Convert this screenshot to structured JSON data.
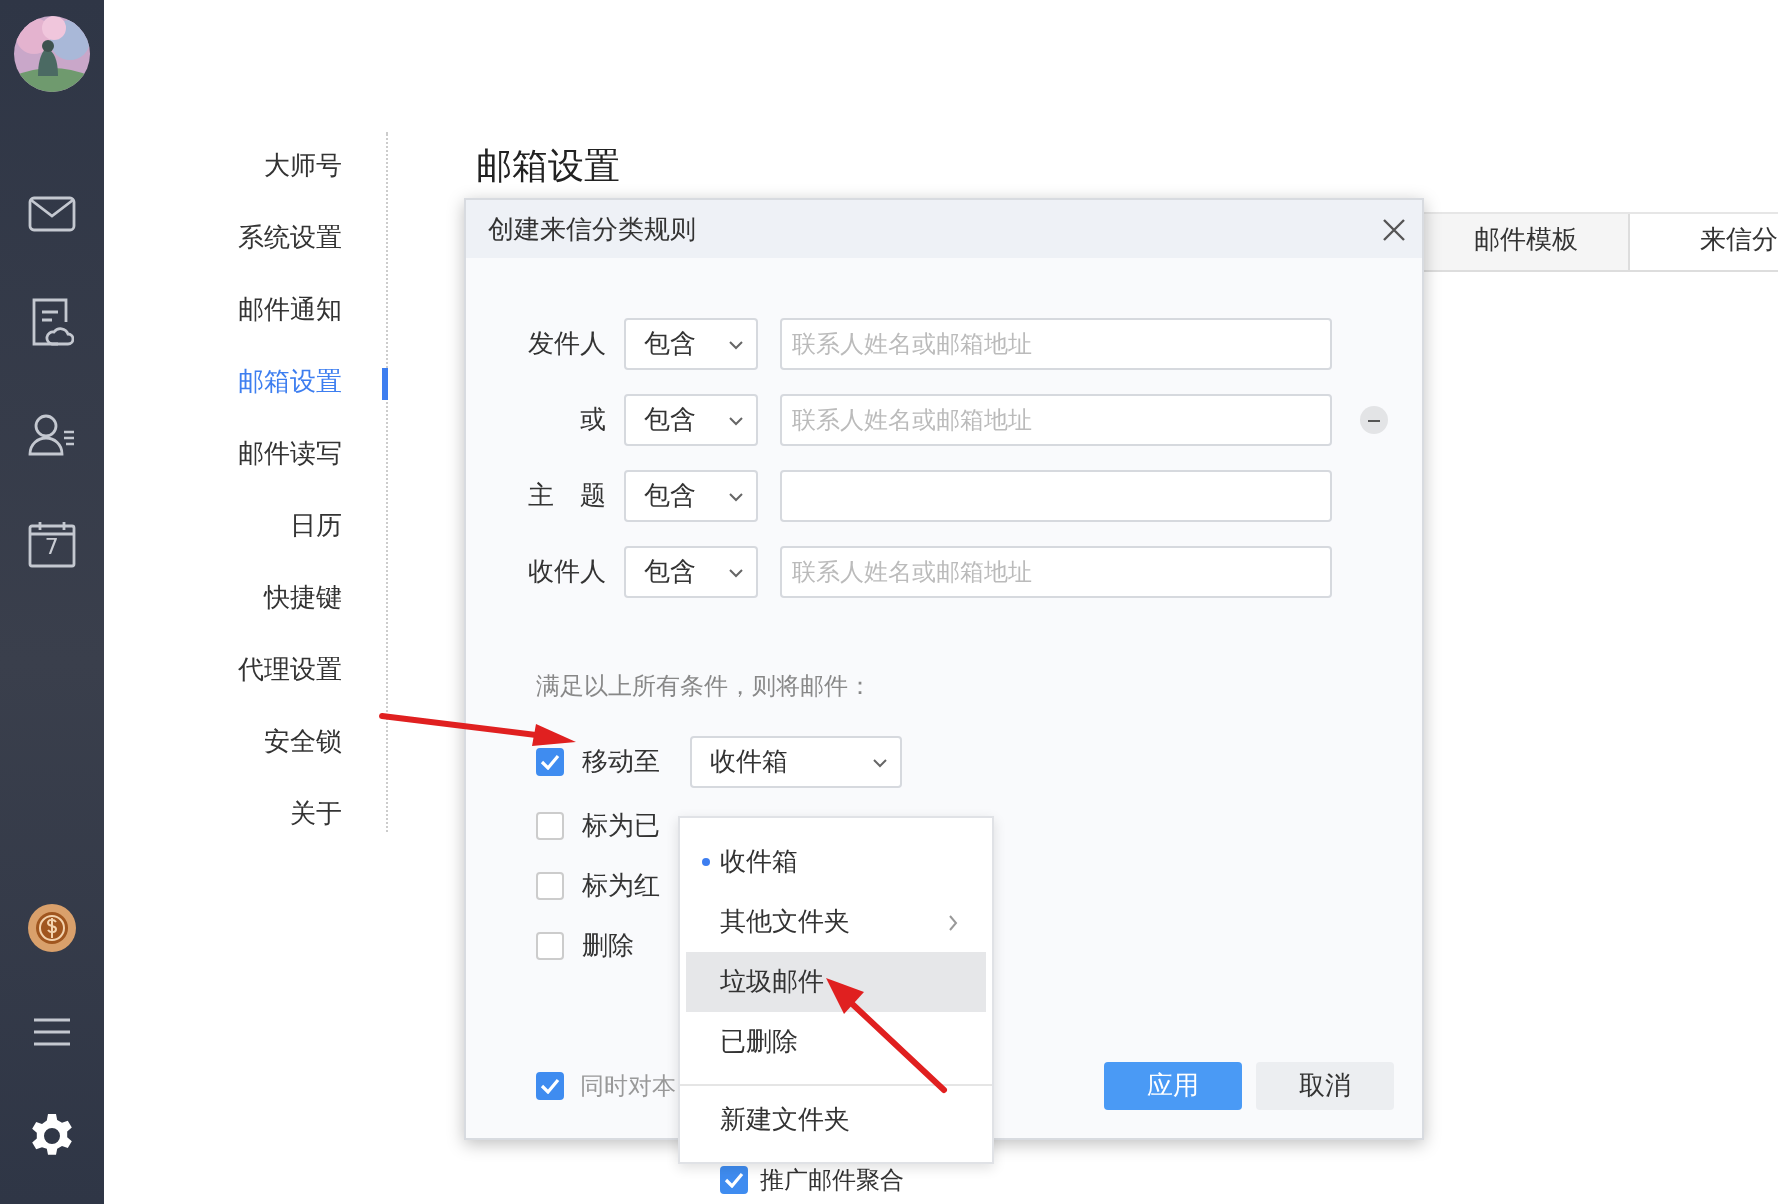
{
  "sidebar": {
    "calendar_day": "7"
  },
  "settings_nav": [
    {
      "label": "大师号",
      "selected": false
    },
    {
      "label": "系统设置",
      "selected": false
    },
    {
      "label": "邮件通知",
      "selected": false
    },
    {
      "label": "邮箱设置",
      "selected": true
    },
    {
      "label": "邮件读写",
      "selected": false
    },
    {
      "label": "日历",
      "selected": false
    },
    {
      "label": "快捷键",
      "selected": false
    },
    {
      "label": "代理设置",
      "selected": false
    },
    {
      "label": "安全锁",
      "selected": false
    },
    {
      "label": "关于",
      "selected": false
    }
  ],
  "page_title": "邮箱设置",
  "tabs": [
    {
      "label": "邮件模板",
      "selected": false
    },
    {
      "label": "来信分",
      "selected": true
    }
  ],
  "background_option": {
    "label": "推广邮件聚合",
    "checked": true
  },
  "dialog": {
    "title": "创建来信分类规则",
    "conditions": [
      {
        "label": "发件人",
        "operator": "包含",
        "placeholder": "联系人姓名或邮箱地址",
        "removable": false
      },
      {
        "label": "或",
        "operator": "包含",
        "placeholder": "联系人姓名或邮箱地址",
        "removable": true
      },
      {
        "label": "主　题",
        "operator": "包含",
        "removable": false
      },
      {
        "label": "收件人",
        "operator": "包含",
        "placeholder": "联系人姓名或邮箱地址",
        "removable": false
      }
    ],
    "action_prompt": "满足以上所有条件，则将邮件：",
    "actions": [
      {
        "kind": "select",
        "label": "移动至",
        "checked": true,
        "value": "收件箱"
      },
      {
        "kind": "plain",
        "label": "标为已",
        "checked": false
      },
      {
        "kind": "plain",
        "label": "标为红",
        "checked": false
      },
      {
        "kind": "plain",
        "label": "删除",
        "checked": false
      }
    ],
    "bottom_option": {
      "label": "同时对本",
      "checked": true
    },
    "buttons": [
      {
        "label": "应用",
        "kind": "primary"
      },
      {
        "label": "取消",
        "kind": "secondary"
      }
    ],
    "dropdown": [
      {
        "kind": "item",
        "label": "收件箱",
        "selected": true,
        "hovered": false
      },
      {
        "kind": "submenu",
        "label": "其他文件夹",
        "selected": false,
        "hovered": false
      },
      {
        "kind": "item",
        "label": "垃圾邮件",
        "selected": false,
        "hovered": true
      },
      {
        "kind": "item",
        "label": "已删除",
        "selected": false,
        "hovered": false
      },
      {
        "kind": "divider"
      },
      {
        "kind": "item",
        "label": "新建文件夹",
        "selected": false,
        "hovered": false
      }
    ]
  }
}
